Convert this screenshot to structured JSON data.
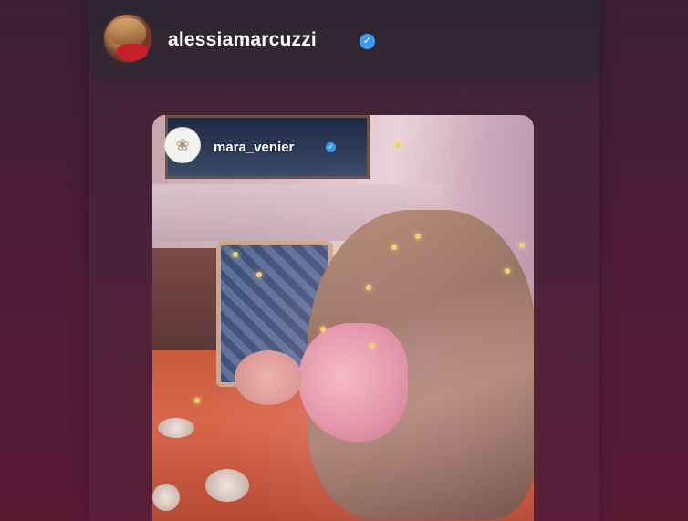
{
  "story": {
    "username": "alessiamarcuzzi",
    "verified_icon": "verified-badge-icon",
    "accent_color": "#3d9bf0"
  },
  "embedded_story": {
    "username": "mara_venier",
    "verified_icon": "verified-badge-icon"
  },
  "icons": {
    "verified_glyph": "✓",
    "embed_avatar_glyph": "❀"
  }
}
